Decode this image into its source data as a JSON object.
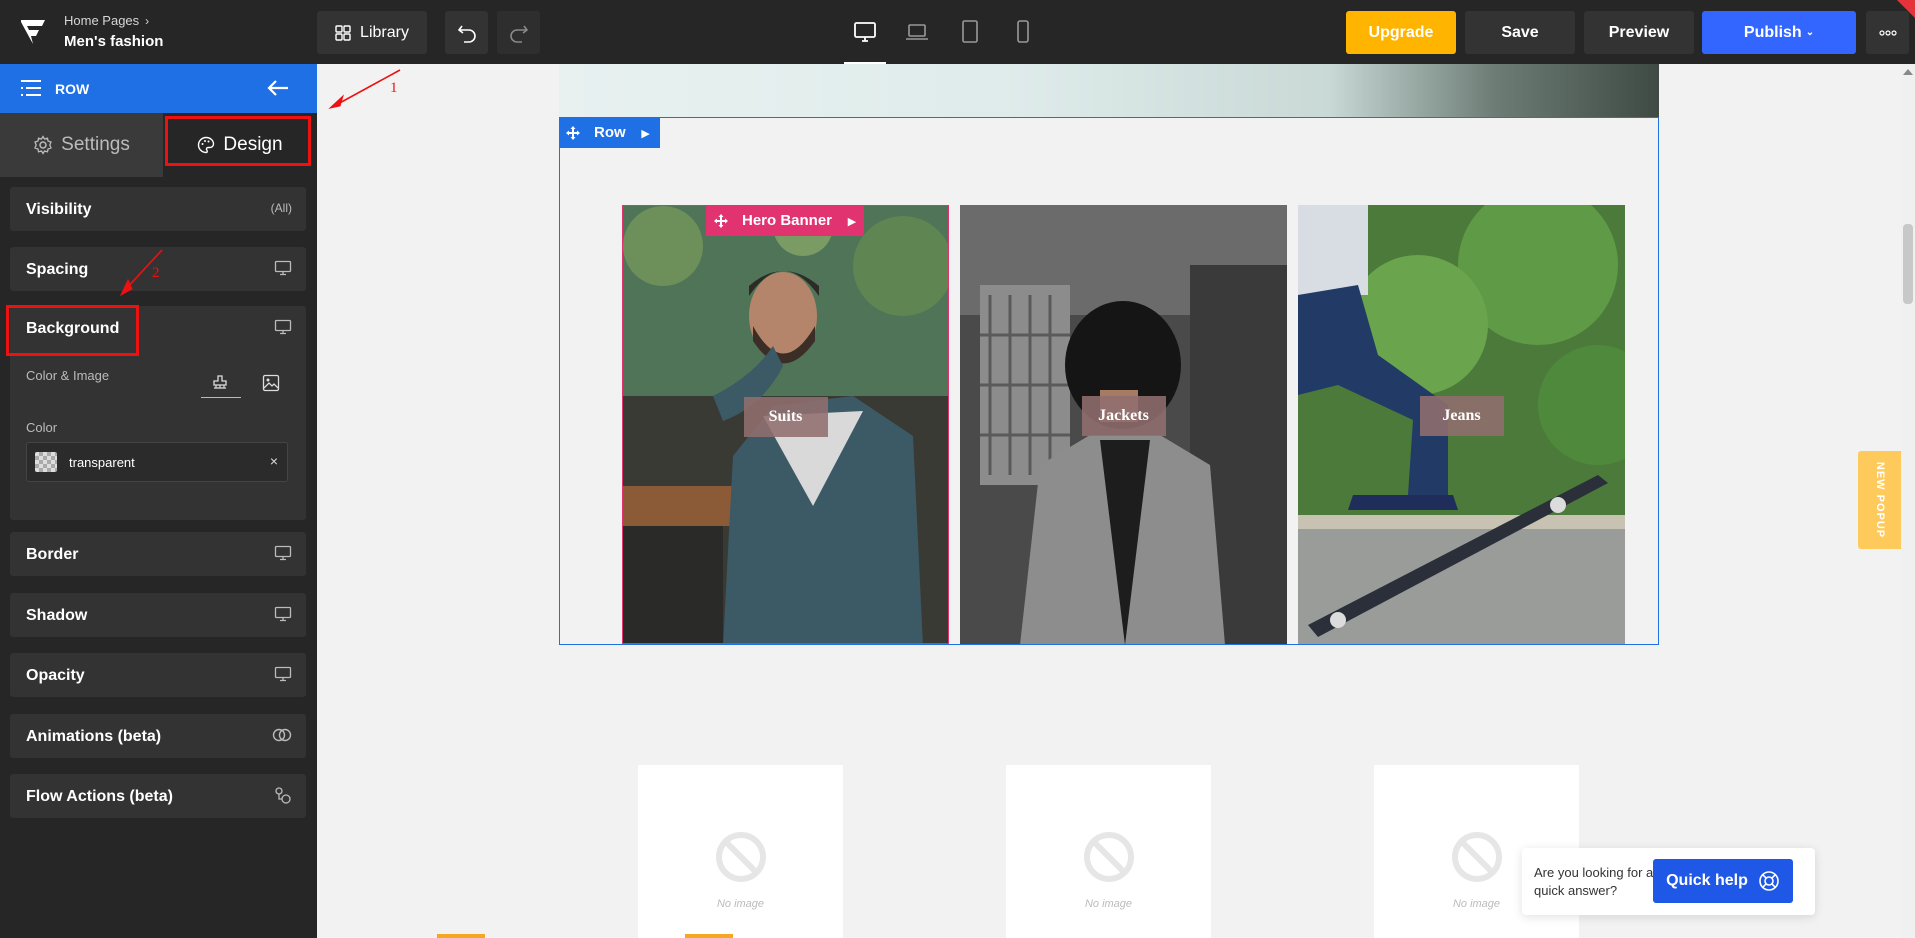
{
  "breadcrumb": {
    "parent": "Home Pages",
    "page": "Men's fashion"
  },
  "toolbar": {
    "library_label": "Library",
    "upgrade_label": "Upgrade",
    "save_label": "Save",
    "preview_label": "Preview",
    "publish_label": "Publish",
    "devices": [
      "desktop-icon",
      "laptop-icon",
      "tablet-icon",
      "mobile-icon"
    ],
    "active_device": "desktop"
  },
  "panel": {
    "header_title": "ROW",
    "tabs": {
      "settings": "Settings",
      "design": "Design"
    },
    "active_tab": "Design",
    "sections": {
      "visibility": {
        "label": "Visibility",
        "value": "(All)"
      },
      "spacing": {
        "label": "Spacing"
      },
      "background": {
        "label": "Background",
        "color_image_label": "Color & Image",
        "color_label": "Color",
        "color_value": "transparent"
      },
      "border": {
        "label": "Border"
      },
      "shadow": {
        "label": "Shadow"
      },
      "opacity": {
        "label": "Opacity"
      },
      "animations": {
        "label": "Animations (beta)"
      },
      "flow_actions": {
        "label": "Flow Actions (beta)"
      }
    }
  },
  "canvas": {
    "row_tag": "Row",
    "hero_tag": "Hero Banner",
    "cards": [
      {
        "label": "Suits"
      },
      {
        "label": "Jackets"
      },
      {
        "label": "Jeans"
      }
    ],
    "placeholders": [
      "No image",
      "No image",
      "No image"
    ],
    "new_popup": "NEW POPUP",
    "quick_help": {
      "question": "Are you looking for a quick answer?",
      "button": "Quick help"
    }
  },
  "annotations": [
    "1",
    "2"
  ],
  "colors": {
    "accent_blue": "#1f6fe5",
    "upgrade_yellow": "#ffb400",
    "publish_blue": "#3366ff",
    "hero_pink": "#e0336f",
    "annotation_red": "#e11111"
  }
}
